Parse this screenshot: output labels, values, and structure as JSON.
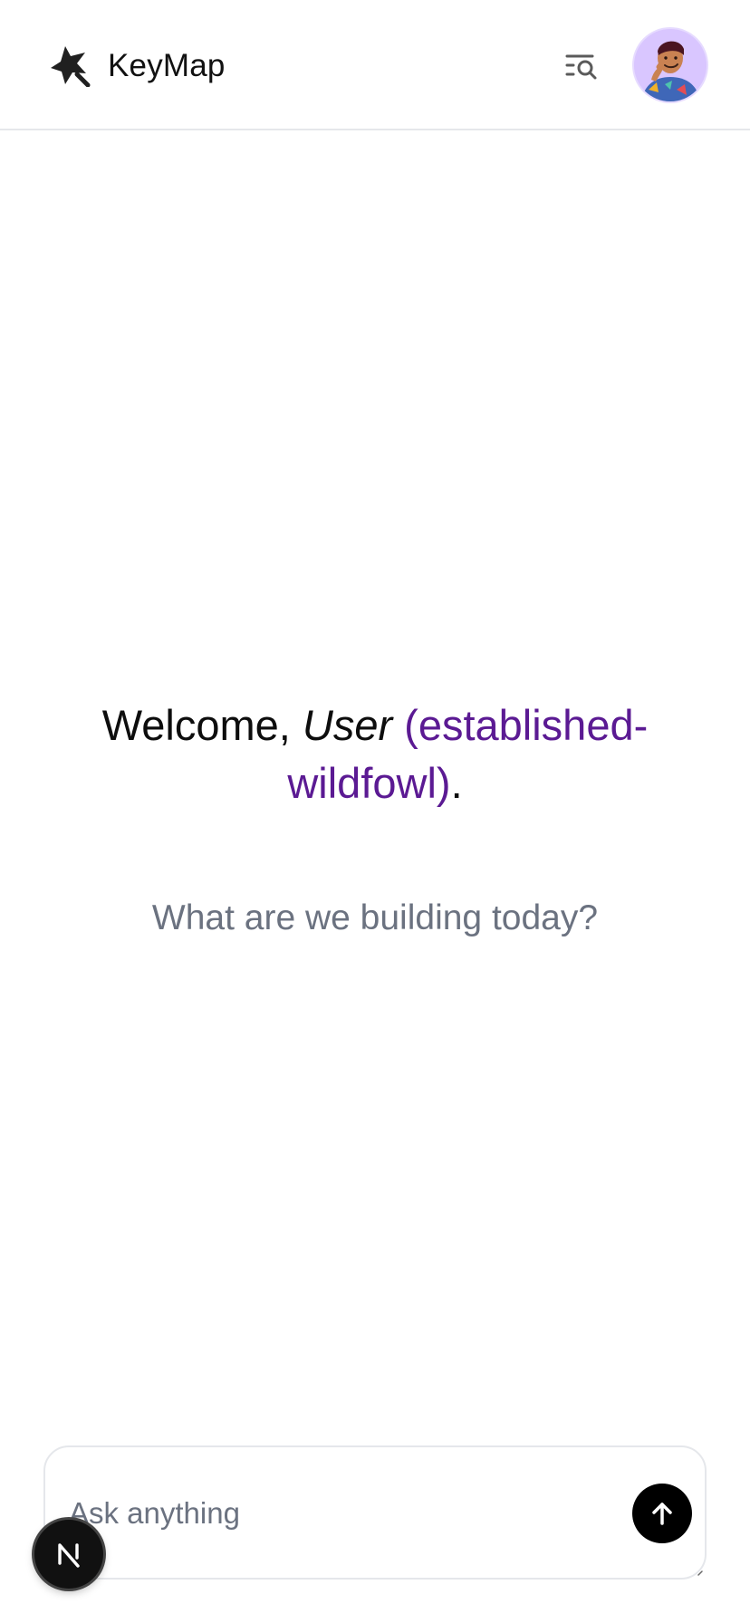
{
  "header": {
    "logo_icon": "star-sparkle-logo-icon",
    "title": "KeyMap",
    "search_history_icon": "list-search-icon",
    "avatar_icon": "user-avatar-illustration"
  },
  "hero": {
    "welcome_prefix": "Welcome, ",
    "user_label": "User",
    "username_display": " (established-wildfowl)",
    "punctuation": ".",
    "subtitle": "What are we building today?"
  },
  "composer": {
    "placeholder": "Ask anything",
    "value": "",
    "send_icon": "arrow-up-icon"
  },
  "overlay": {
    "badge_letter": "N",
    "badge_icon": "nextjs-logo-icon"
  },
  "colors": {
    "accent_purple": "#5b1a93",
    "text_primary": "#0d0d0d",
    "text_muted": "#6b7280",
    "border": "#e5e7eb",
    "send_button": "#000000"
  }
}
